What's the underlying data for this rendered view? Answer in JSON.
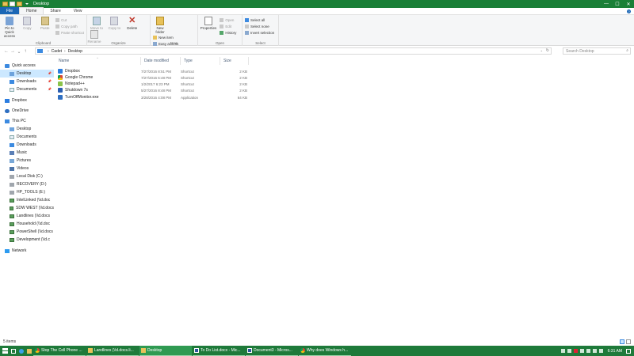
{
  "window": {
    "title": "Desktop",
    "controls": {
      "minimize": "—",
      "maximize": "☐",
      "close": "✕"
    }
  },
  "ribbon_tabs": [
    {
      "label": "File"
    },
    {
      "label": "Home"
    },
    {
      "label": "Share"
    },
    {
      "label": "View"
    }
  ],
  "ribbon": {
    "clipboard": {
      "name": "Clipboard",
      "pin": "Pin to Quick access",
      "copy": "Copy",
      "paste": "Paste",
      "cut": "Cut",
      "copy_path": "Copy path",
      "paste_shortcut": "Paste shortcut"
    },
    "organize": {
      "name": "Organize",
      "move_to": "Move to",
      "copy_to": "Copy to",
      "delete": "Delete",
      "rename": "Rename"
    },
    "new": {
      "name": "New",
      "new_folder": "New folder",
      "new_item": "New item",
      "easy_access": "Easy access"
    },
    "open": {
      "name": "Open",
      "properties": "Properties",
      "open": "Open",
      "edit": "Edit",
      "history": "History"
    },
    "select": {
      "name": "Select",
      "select_all": "Select all",
      "select_none": "Select none",
      "invert": "Invert selection"
    }
  },
  "address": {
    "breadcrumb": [
      "Cadet",
      "Desktop"
    ],
    "search_placeholder": "Search Desktop"
  },
  "nav_pane": [
    {
      "label": "Quick access",
      "icon": "star-icon"
    },
    {
      "label": "Desktop",
      "icon": "folder-icon",
      "pinned": true
    },
    {
      "label": "Downloads",
      "icon": "download-icon",
      "pinned": true
    },
    {
      "label": "Documents",
      "icon": "document-icon",
      "pinned": true
    },
    {
      "label": "Dropbox",
      "icon": "dropbox-icon"
    },
    {
      "label": "OneDrive",
      "icon": "cloud-icon"
    },
    {
      "label": "This PC",
      "icon": "pc-icon"
    },
    {
      "label": "Desktop",
      "icon": "folder-icon"
    },
    {
      "label": "Documents",
      "icon": "document-icon"
    },
    {
      "label": "Downloads",
      "icon": "download-icon"
    },
    {
      "label": "Music",
      "icon": "music-icon"
    },
    {
      "label": "Pictures",
      "icon": "pictures-icon"
    },
    {
      "label": "Videos",
      "icon": "videos-icon"
    },
    {
      "label": "Local Disk (C:)",
      "icon": "disk-icon"
    },
    {
      "label": "RECOVERY (D:)",
      "icon": "disk-icon"
    },
    {
      "label": "HP_TOOLS (E:)",
      "icon": "disk-icon"
    },
    {
      "label": "IntelLinked (\\\\d.doc",
      "icon": "network-drive-icon"
    },
    {
      "label": "SDW WEST (\\\\d.docs",
      "icon": "network-drive-icon"
    },
    {
      "label": "Landlines (\\\\d.docs",
      "icon": "network-drive-icon"
    },
    {
      "label": "Household (\\\\d.doc",
      "icon": "network-drive-icon"
    },
    {
      "label": "PowerShell (\\\\d.docs",
      "icon": "network-drive-icon"
    },
    {
      "label": "Development (\\\\d.c",
      "icon": "network-drive-icon"
    },
    {
      "label": "Network",
      "icon": "network-icon"
    }
  ],
  "file_list": {
    "columns": [
      "Name",
      "Date modified",
      "Type",
      "Size"
    ],
    "rows": [
      {
        "name": "Dropbox",
        "date": "7/27/2016 8:51 PM",
        "type": "Shortcut",
        "size": "2 KB",
        "icon": "dropbox-icon"
      },
      {
        "name": "Google Chrome",
        "date": "7/27/2016 6:48 PM",
        "type": "Shortcut",
        "size": "2 KB",
        "icon": "chrome-icon"
      },
      {
        "name": "Notepad++",
        "date": "1/2/2017 6:23 PM",
        "type": "Shortcut",
        "size": "2 KB",
        "icon": "notepadpp-icon"
      },
      {
        "name": "Shutdown 7s",
        "date": "5/27/2016 8:48 PM",
        "type": "Shortcut",
        "size": "2 KB",
        "icon": "shutdown-icon"
      },
      {
        "name": "TurnOffMonitor.exe",
        "date": "3/28/2016 4:08 PM",
        "type": "Application",
        "size": "64 KB",
        "icon": "exe-icon"
      }
    ]
  },
  "status": {
    "items": "5 items"
  },
  "taskbar": {
    "tasks": [
      {
        "label": "Stop The Cell Phone ...",
        "icon": "chrome-icon"
      },
      {
        "label": "Landlines (\\\\d.docs.li...",
        "icon": "folder-icon"
      },
      {
        "label": "Desktop",
        "icon": "folder-icon",
        "active": true
      },
      {
        "label": "To Do List.docx - Mic...",
        "icon": "word-icon"
      },
      {
        "label": "Document3 - Micros...",
        "icon": "word-icon"
      },
      {
        "label": "Why does Windows h...",
        "icon": "chrome-icon"
      }
    ],
    "clock": "6:31 AM"
  }
}
